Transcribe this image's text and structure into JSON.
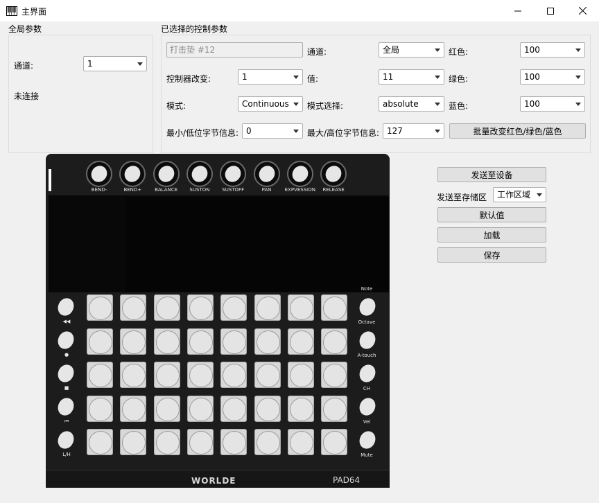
{
  "window": {
    "title": "主界面",
    "controls": {
      "minimize": "minimize-icon",
      "maximize": "maximize-icon",
      "close": "close-icon"
    }
  },
  "global_params": {
    "title": "全局参数",
    "channel_label": "通道:",
    "channel_value": "1",
    "status": "未连接"
  },
  "selected_params": {
    "title": "已选择的控制参数",
    "element_name_placeholder": "打击垫 #12",
    "channel_label": "通道:",
    "channel_value": "全局",
    "red_label": "红色:",
    "red_value": "100",
    "controller_change_label": "控制器改变:",
    "controller_change_value": "1",
    "value_label": "值:",
    "value_value": "11",
    "green_label": "绿色:",
    "green_value": "100",
    "mode_label": "模式:",
    "mode_value": "Continuous",
    "mode_select_label": "模式选择:",
    "mode_select_value": "absolute",
    "blue_label": "蓝色:",
    "blue_value": "100",
    "min_label": "最小/低位字节信息:",
    "min_value": "0",
    "max_label": "最大/高位字节信息:",
    "max_value": "127",
    "batch_button": "批量改变红色/绿色/蓝色"
  },
  "actions": {
    "send_to_device": "发送至设备",
    "send_to_storage_label": "发送至存储区",
    "storage_value": "工作区域",
    "default_values": "默认值",
    "load": "加载",
    "save": "保存"
  },
  "device": {
    "knobs": [
      "BEND-",
      "BEND+",
      "BALANCE",
      "SUSTON",
      "SUSTOFF",
      "PAN",
      "EXPVESSION",
      "RELEASE"
    ],
    "left_buttons": [
      "◀◀",
      "●",
      "■",
      "⏮",
      "L/H"
    ],
    "right_top_label": "Note",
    "right_buttons": [
      "Octave",
      "A-touch",
      "CH",
      "Vel",
      "Mute"
    ],
    "brand": "WORLDE",
    "model": "PAD64"
  }
}
